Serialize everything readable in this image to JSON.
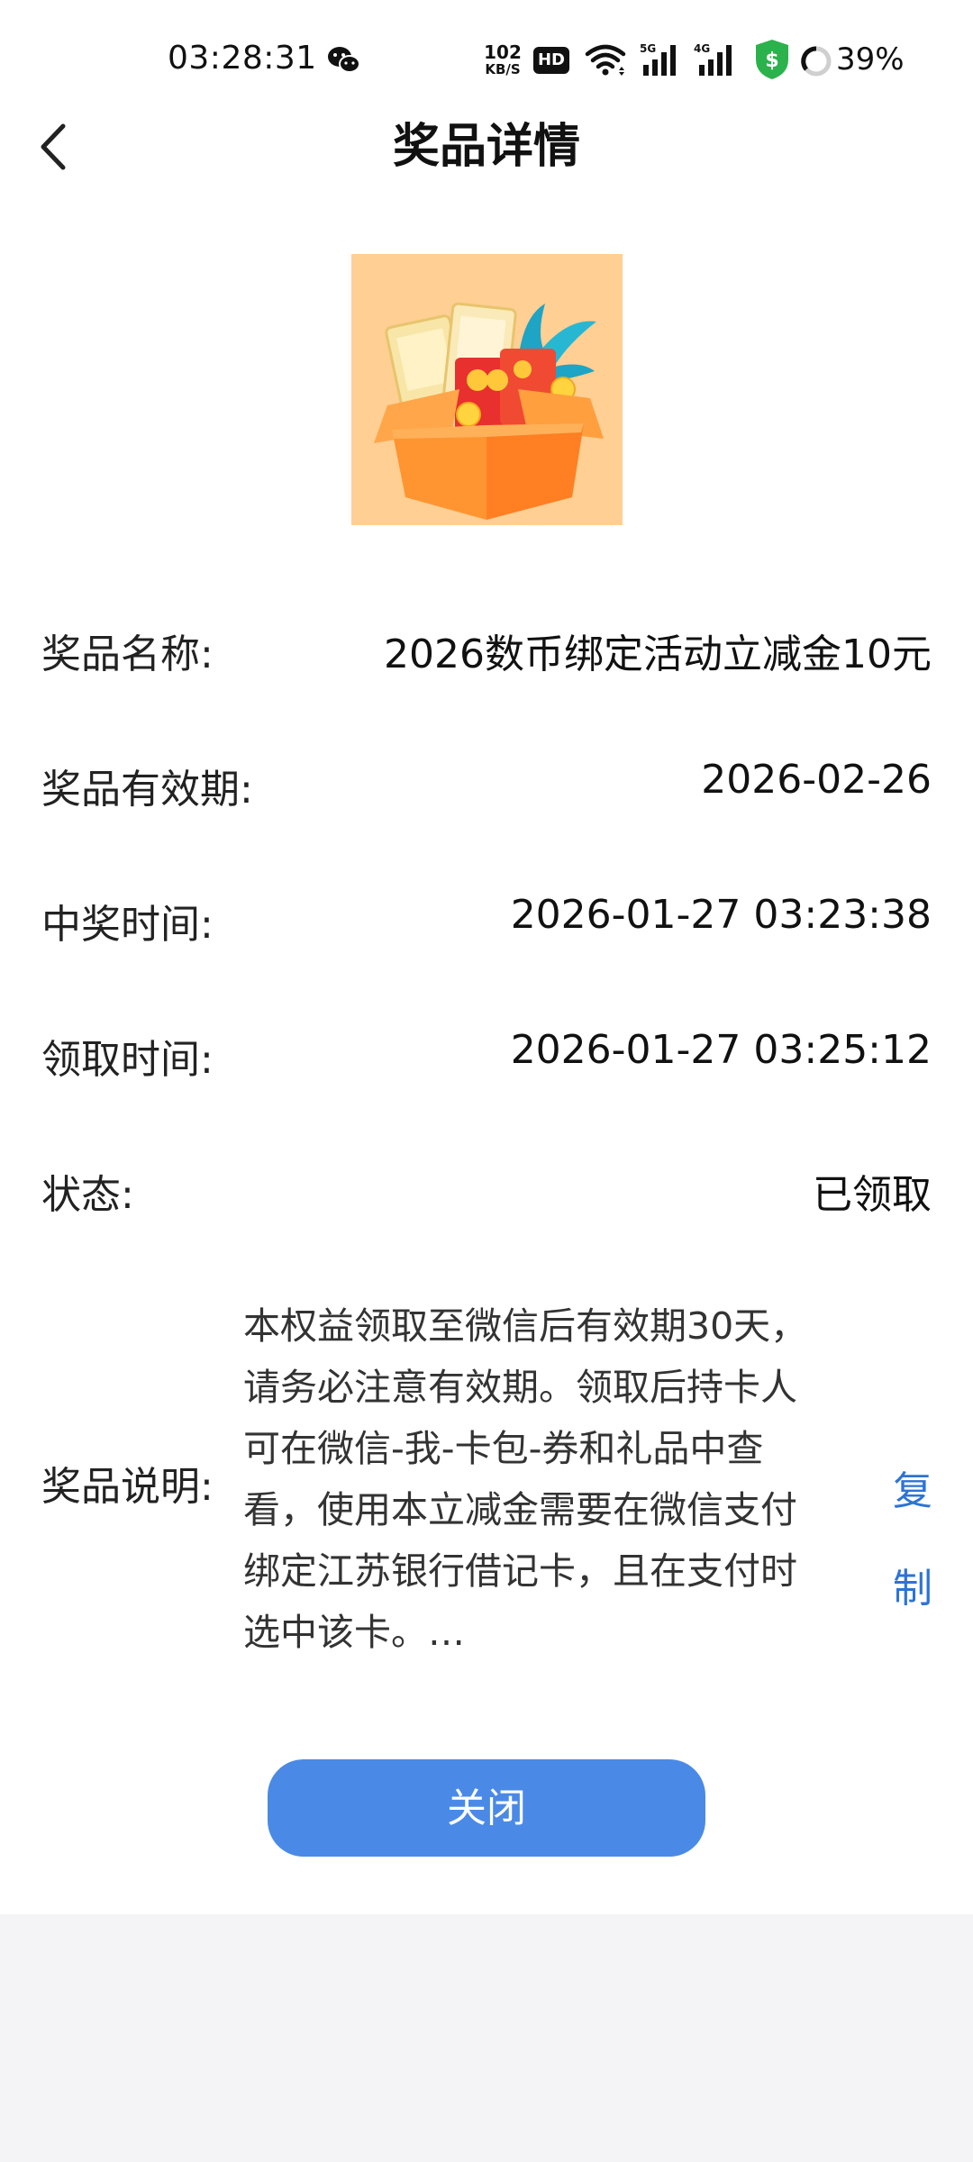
{
  "status_bar": {
    "time": "03:28:31",
    "net_speed_value": "102",
    "net_speed_unit": "KB/S",
    "hd_label": "HD",
    "battery": "39%",
    "icons": [
      "wechat-icon",
      "hd-icon",
      "wifi-icon",
      "signal-5g-icon",
      "signal-4g-icon",
      "security-shield-icon",
      "battery-ring-icon"
    ]
  },
  "header": {
    "title": "奖品详情",
    "back_icon": "chevron-left-icon"
  },
  "prize_image": {
    "icon": "gift-box-icon",
    "background_color": "#ffcf93"
  },
  "details": {
    "name_label": "奖品名称:",
    "name_value": "2026数币绑定活动立减金10元",
    "validity_label": "奖品有效期:",
    "validity_value": "2026-02-26",
    "win_time_label": "中奖时间:",
    "win_time_value": "2026-01-27 03:23:38",
    "claim_time_label": "领取时间:",
    "claim_time_value": "2026-01-27 03:25:12",
    "status_label": "状态:",
    "status_value": "已领取",
    "description_label": "奖品说明:",
    "description_value": "本权益领取至微信后有效期30天，请务必注意有效期。领取后持卡人可在微信-我-卡包-券和礼品中查看，使用本立减金需要在微信支付绑定江苏银行借记卡，且在支付时选中该卡。…",
    "copy_label": "复制"
  },
  "footer": {
    "close_label": "关闭"
  },
  "colors": {
    "primary_button": "#4a8ae6",
    "link": "#2d73d6",
    "page_background": "#ffffff",
    "bottom_background": "#f4f4f6",
    "security_green": "#2bb24c"
  }
}
